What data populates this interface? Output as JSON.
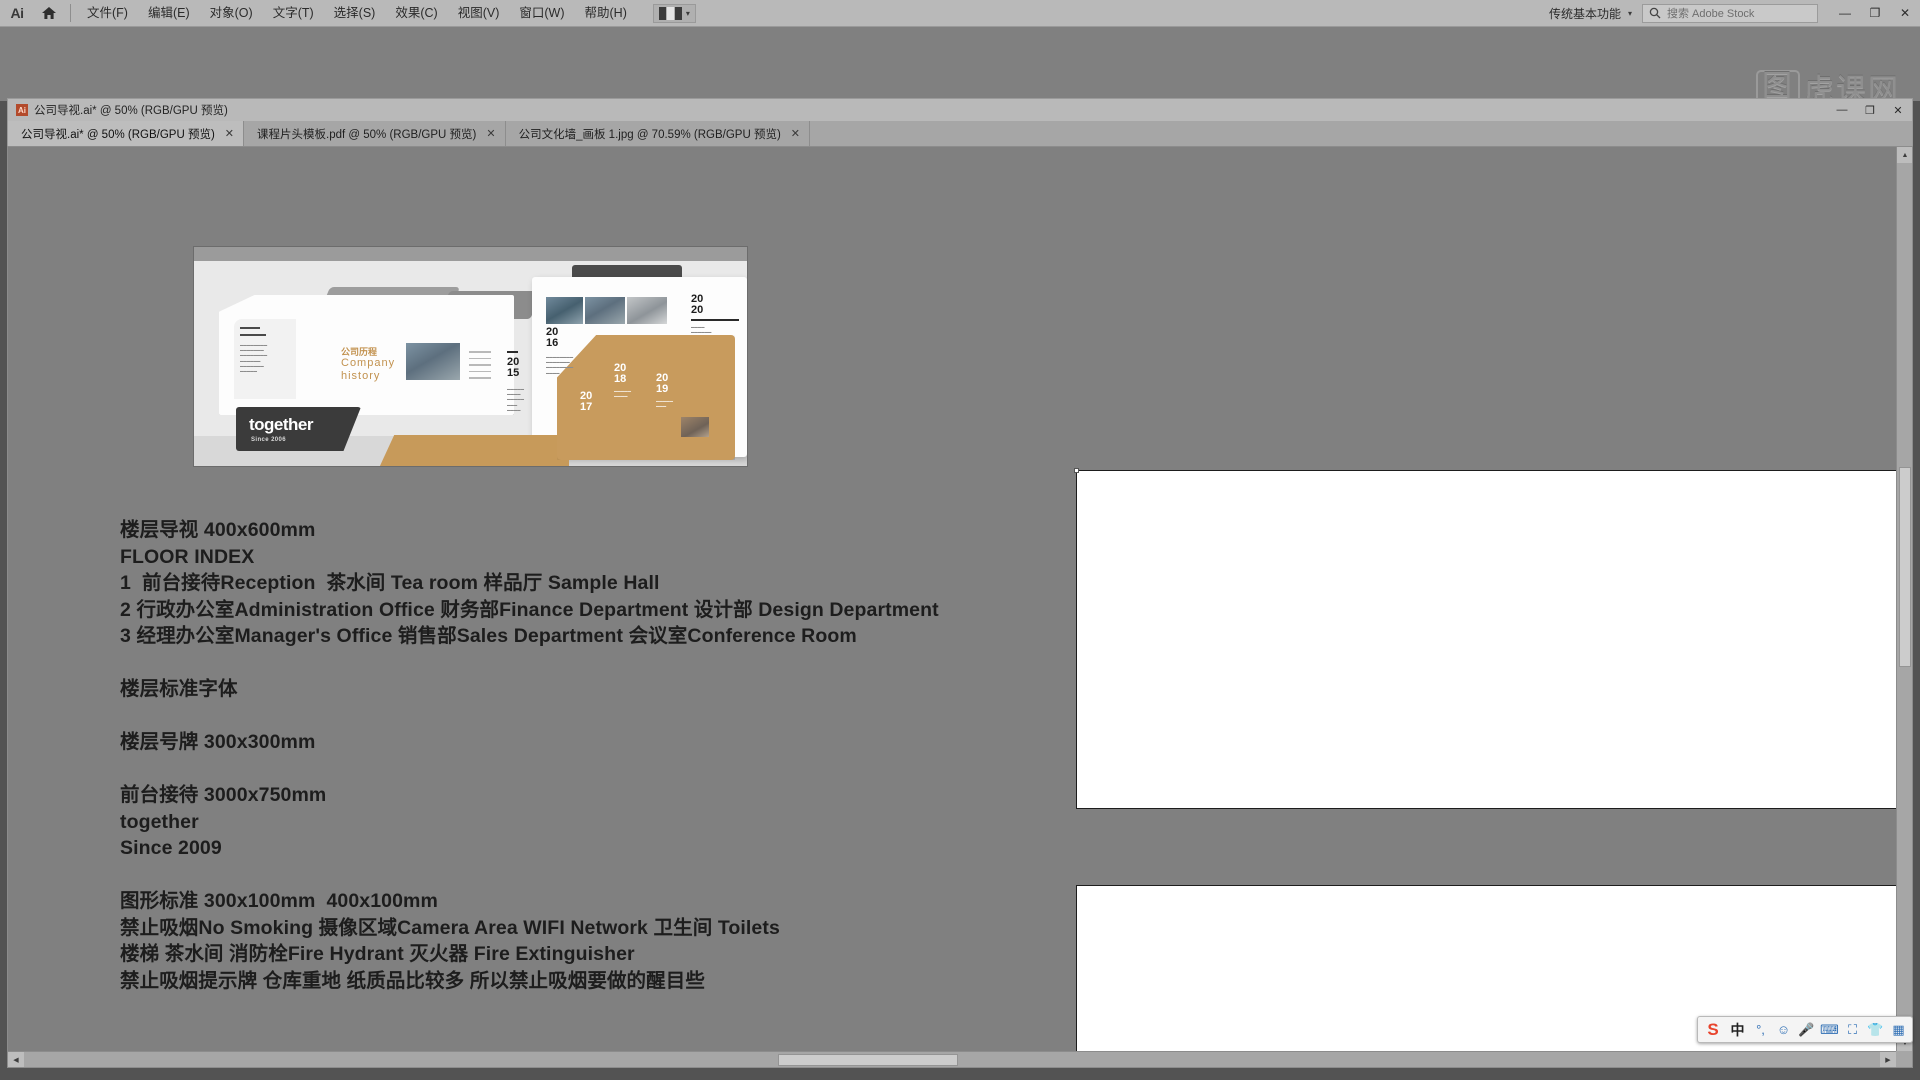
{
  "app": {
    "name": "Ai",
    "logo_label": "Ai",
    "home_icon": "home-icon"
  },
  "menubar": {
    "items": [
      {
        "label": "文件(F)"
      },
      {
        "label": "编辑(E)"
      },
      {
        "label": "对象(O)"
      },
      {
        "label": "文字(T)"
      },
      {
        "label": "选择(S)"
      },
      {
        "label": "效果(C)"
      },
      {
        "label": "视图(V)"
      },
      {
        "label": "窗口(W)"
      },
      {
        "label": "帮助(H)"
      }
    ],
    "arrange_documents": {
      "icon": "arrange-documents-icon",
      "caret": "▾"
    },
    "workspace": {
      "label": "传统基本功能",
      "caret": "▾"
    },
    "stock_search": {
      "icon": "search-icon",
      "placeholder": "搜索 Adobe Stock",
      "value": ""
    },
    "window_controls": {
      "minimize": "—",
      "restore": "❐",
      "close": "✕"
    }
  },
  "watermark": {
    "mark": "图",
    "text": "虎课网"
  },
  "document_window": {
    "title": "公司导视.ai* @ 50% (RGB/GPU 预览)",
    "file_badge": "Ai",
    "controls": {
      "minimize": "—",
      "restore": "❐",
      "close": "✕"
    }
  },
  "tabs": [
    {
      "label": "公司导视.ai* @ 50% (RGB/GPU 预览)",
      "close": "✕",
      "active": true
    },
    {
      "label": "课程片头模板.pdf @ 50% (RGB/GPU 预览)",
      "close": "✕",
      "active": false
    },
    {
      "label": "公司文化墙_画板 1.jpg @ 70.59% (RGB/GPU 预览)",
      "close": "✕",
      "active": false
    }
  ],
  "artwork": {
    "title_cn": "公司历程",
    "title_en_line1": "Company",
    "title_en_line2": "history",
    "brand": "together",
    "since": "Since 2006",
    "years": [
      {
        "top": "20",
        "bottom": "15"
      },
      {
        "top": "20",
        "bottom": "16"
      },
      {
        "top": "20",
        "bottom": "17"
      },
      {
        "top": "20",
        "bottom": "18"
      },
      {
        "top": "20",
        "bottom": "19"
      },
      {
        "top": "20",
        "bottom": "20"
      }
    ]
  },
  "canvas_text": {
    "lines": [
      "楼层导视 400x600mm",
      "FLOOR INDEX",
      "1  前台接待Reception  茶水间 Tea room 样品厅 Sample Hall",
      "2 行政办公室Administration Office 财务部Finance Department 设计部 Design Department",
      "3 经理办公室Manager's Office 销售部Sales Department 会议室Conference Room",
      "",
      "楼层标准字体",
      "",
      "楼层号牌 300x300mm",
      "",
      "前台接待 3000x750mm",
      "together",
      "Since 2009",
      "",
      "图形标准 300x100mm  400x100mm",
      "禁止吸烟No Smoking 摄像区域Camera Area WIFI Network 卫生间 Toilets",
      "楼梯 茶水间 消防栓Fire Hydrant 灭火器 Fire Extinguisher",
      "禁止吸烟提示牌 仓库重地 纸质品比较多 所以禁止吸烟要做的醒目些"
    ]
  },
  "ime": {
    "buttons": [
      {
        "icon": "sogou-logo-icon",
        "label": "S"
      },
      {
        "icon": "chinese-mode-icon",
        "label": "中"
      },
      {
        "icon": "punctuation-icon",
        "label": "°,"
      },
      {
        "icon": "emoji-icon",
        "label": "☺"
      },
      {
        "icon": "microphone-icon",
        "label": "🎤"
      },
      {
        "icon": "soft-keyboard-icon",
        "label": "⌨"
      },
      {
        "icon": "screenshot-icon",
        "label": "⛶"
      },
      {
        "icon": "skin-icon",
        "label": "👕"
      },
      {
        "icon": "toolbox-icon",
        "label": "▦"
      }
    ]
  },
  "colors": {
    "chrome": "#b9b9b9",
    "canvas": "#808080",
    "gold": "#c89b5d",
    "dark": "#3b3b3b"
  }
}
